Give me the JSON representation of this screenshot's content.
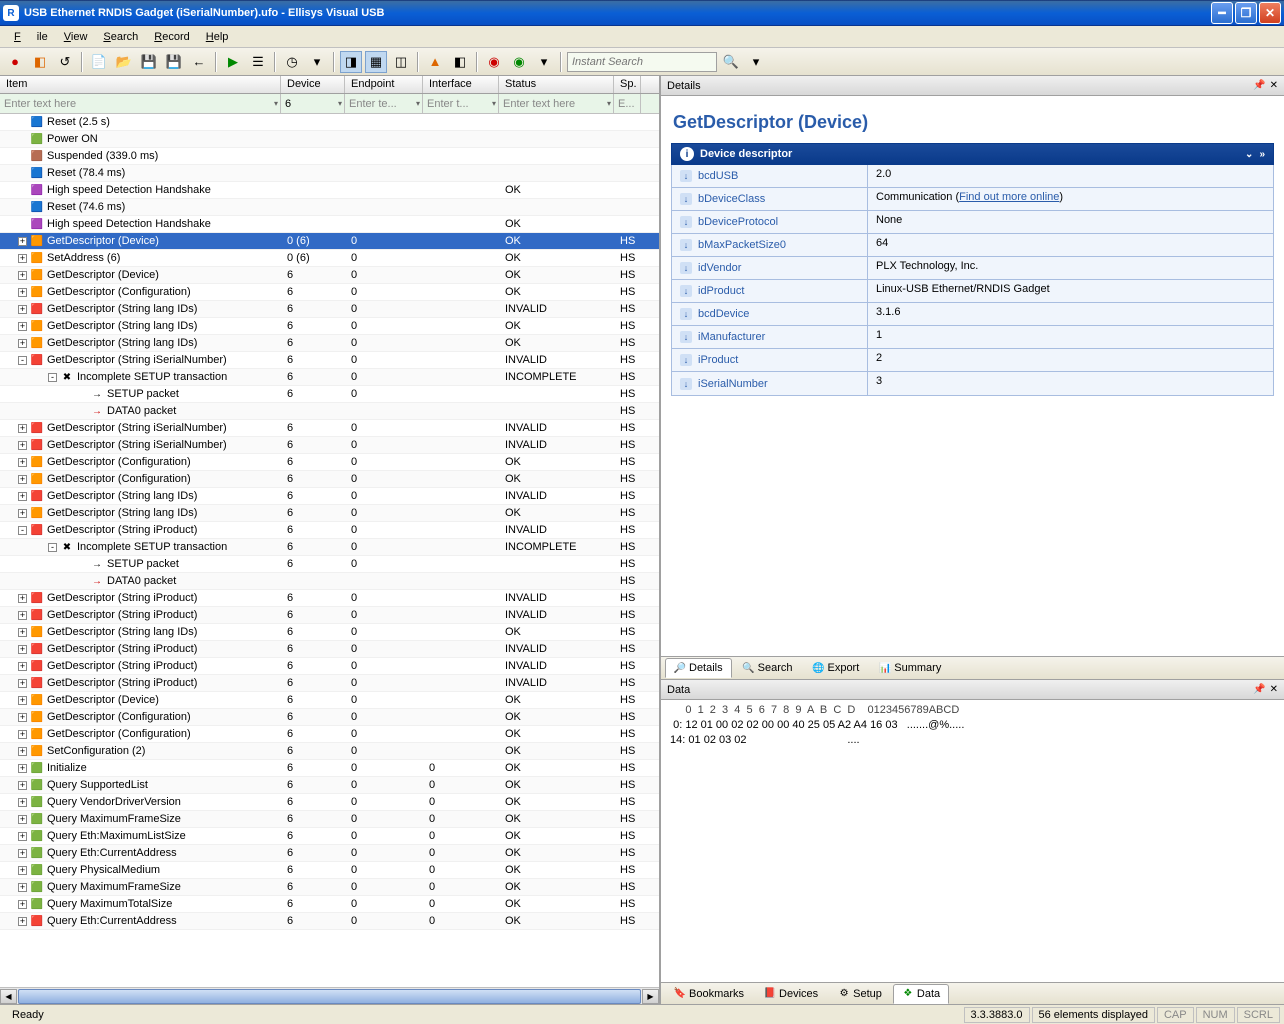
{
  "window": {
    "title": "USB Ethernet RNDIS Gadget (iSerialNumber).ufo - Ellisys Visual USB"
  },
  "menu": [
    "File",
    "View",
    "Search",
    "Record",
    "Help"
  ],
  "toolbar": {
    "search_placeholder": "Instant Search"
  },
  "grid": {
    "columns": [
      "Item",
      "Device",
      "Endpoint",
      "Interface",
      "Status",
      "Sp."
    ],
    "filters": {
      "item": "Enter text here",
      "device": "6",
      "endpoint": "Enter te...",
      "interface": "Enter t...",
      "status": "Enter text here",
      "sp": "E..."
    },
    "rows": [
      {
        "i": 1,
        "exp": "",
        "ind": 1,
        "ico": "🟦",
        "name": "Reset (2.5 s)"
      },
      {
        "i": 2,
        "exp": "",
        "ind": 1,
        "ico": "🟩",
        "name": "Power ON"
      },
      {
        "i": 3,
        "exp": "",
        "ind": 1,
        "ico": "🟫",
        "name": "Suspended (339.0 ms)"
      },
      {
        "i": 4,
        "exp": "",
        "ind": 1,
        "ico": "🟦",
        "name": "Reset (78.4 ms)"
      },
      {
        "i": 5,
        "exp": "",
        "ind": 1,
        "ico": "🟪",
        "name": "High speed Detection Handshake",
        "stat": "OK"
      },
      {
        "i": 6,
        "exp": "",
        "ind": 1,
        "ico": "🟦",
        "name": "Reset (74.6 ms)"
      },
      {
        "i": 7,
        "exp": "",
        "ind": 1,
        "ico": "🟪",
        "name": "High speed Detection Handshake",
        "stat": "OK"
      },
      {
        "i": 8,
        "exp": "+",
        "ind": 1,
        "ico": "🟧",
        "name": "GetDescriptor (Device)",
        "dev": "0 (6)",
        "end": "0",
        "stat": "OK",
        "sp": "HS",
        "sel": true
      },
      {
        "i": 9,
        "exp": "+",
        "ind": 1,
        "ico": "🟧",
        "name": "SetAddress (6)",
        "dev": "0 (6)",
        "end": "0",
        "stat": "OK",
        "sp": "HS"
      },
      {
        "i": 10,
        "exp": "+",
        "ind": 1,
        "ico": "🟧",
        "name": "GetDescriptor (Device)",
        "dev": "6",
        "end": "0",
        "stat": "OK",
        "sp": "HS"
      },
      {
        "i": 11,
        "exp": "+",
        "ind": 1,
        "ico": "🟧",
        "name": "GetDescriptor (Configuration)",
        "dev": "6",
        "end": "0",
        "stat": "OK",
        "sp": "HS"
      },
      {
        "i": 12,
        "exp": "+",
        "ind": 1,
        "ico": "🟥",
        "name": "GetDescriptor (String lang IDs)",
        "dev": "6",
        "end": "0",
        "stat": "INVALID",
        "sp": "HS"
      },
      {
        "i": 13,
        "exp": "+",
        "ind": 1,
        "ico": "🟧",
        "name": "GetDescriptor (String lang IDs)",
        "dev": "6",
        "end": "0",
        "stat": "OK",
        "sp": "HS"
      },
      {
        "i": 14,
        "exp": "+",
        "ind": 1,
        "ico": "🟧",
        "name": "GetDescriptor (String lang IDs)",
        "dev": "6",
        "end": "0",
        "stat": "OK",
        "sp": "HS"
      },
      {
        "i": 15,
        "exp": "-",
        "ind": 1,
        "ico": "🟥",
        "name": "GetDescriptor (String iSerialNumber)",
        "dev": "6",
        "end": "0",
        "stat": "INVALID",
        "sp": "HS"
      },
      {
        "i": 16,
        "exp": "-",
        "ind": 2,
        "ico": "✖",
        "name": "Incomplete SETUP transaction",
        "dev": "6",
        "end": "0",
        "stat": "INCOMPLETE",
        "sp": "HS"
      },
      {
        "i": 17,
        "exp": "",
        "ind": 3,
        "ico": "→",
        "name": "SETUP packet",
        "dev": "6",
        "end": "0",
        "sp": "HS"
      },
      {
        "i": 18,
        "exp": "",
        "ind": 3,
        "ico": "→",
        "icoCls": "i-red",
        "name": "DATA0 packet",
        "sp": "HS"
      },
      {
        "i": 19,
        "exp": "+",
        "ind": 1,
        "ico": "🟥",
        "name": "GetDescriptor (String iSerialNumber)",
        "dev": "6",
        "end": "0",
        "stat": "INVALID",
        "sp": "HS"
      },
      {
        "i": 20,
        "exp": "+",
        "ind": 1,
        "ico": "🟥",
        "name": "GetDescriptor (String iSerialNumber)",
        "dev": "6",
        "end": "0",
        "stat": "INVALID",
        "sp": "HS"
      },
      {
        "i": 21,
        "exp": "+",
        "ind": 1,
        "ico": "🟧",
        "name": "GetDescriptor (Configuration)",
        "dev": "6",
        "end": "0",
        "stat": "OK",
        "sp": "HS"
      },
      {
        "i": 22,
        "exp": "+",
        "ind": 1,
        "ico": "🟧",
        "name": "GetDescriptor (Configuration)",
        "dev": "6",
        "end": "0",
        "stat": "OK",
        "sp": "HS"
      },
      {
        "i": 23,
        "exp": "+",
        "ind": 1,
        "ico": "🟥",
        "name": "GetDescriptor (String lang IDs)",
        "dev": "6",
        "end": "0",
        "stat": "INVALID",
        "sp": "HS"
      },
      {
        "i": 24,
        "exp": "+",
        "ind": 1,
        "ico": "🟧",
        "name": "GetDescriptor (String lang IDs)",
        "dev": "6",
        "end": "0",
        "stat": "OK",
        "sp": "HS"
      },
      {
        "i": 25,
        "exp": "-",
        "ind": 1,
        "ico": "🟥",
        "name": "GetDescriptor (String iProduct)",
        "dev": "6",
        "end": "0",
        "stat": "INVALID",
        "sp": "HS"
      },
      {
        "i": 26,
        "exp": "-",
        "ind": 2,
        "ico": "✖",
        "name": "Incomplete SETUP transaction",
        "dev": "6",
        "end": "0",
        "stat": "INCOMPLETE",
        "sp": "HS"
      },
      {
        "i": 27,
        "exp": "",
        "ind": 3,
        "ico": "→",
        "name": "SETUP packet",
        "dev": "6",
        "end": "0",
        "sp": "HS"
      },
      {
        "i": 28,
        "exp": "",
        "ind": 3,
        "ico": "→",
        "icoCls": "i-red",
        "name": "DATA0 packet",
        "sp": "HS"
      },
      {
        "i": 29,
        "exp": "+",
        "ind": 1,
        "ico": "🟥",
        "name": "GetDescriptor (String iProduct)",
        "dev": "6",
        "end": "0",
        "stat": "INVALID",
        "sp": "HS"
      },
      {
        "i": 30,
        "exp": "+",
        "ind": 1,
        "ico": "🟥",
        "name": "GetDescriptor (String iProduct)",
        "dev": "6",
        "end": "0",
        "stat": "INVALID",
        "sp": "HS"
      },
      {
        "i": 31,
        "exp": "+",
        "ind": 1,
        "ico": "🟧",
        "name": "GetDescriptor (String lang IDs)",
        "dev": "6",
        "end": "0",
        "stat": "OK",
        "sp": "HS"
      },
      {
        "i": 32,
        "exp": "+",
        "ind": 1,
        "ico": "🟥",
        "name": "GetDescriptor (String iProduct)",
        "dev": "6",
        "end": "0",
        "stat": "INVALID",
        "sp": "HS"
      },
      {
        "i": 33,
        "exp": "+",
        "ind": 1,
        "ico": "🟥",
        "name": "GetDescriptor (String iProduct)",
        "dev": "6",
        "end": "0",
        "stat": "INVALID",
        "sp": "HS"
      },
      {
        "i": 34,
        "exp": "+",
        "ind": 1,
        "ico": "🟥",
        "name": "GetDescriptor (String iProduct)",
        "dev": "6",
        "end": "0",
        "stat": "INVALID",
        "sp": "HS"
      },
      {
        "i": 35,
        "exp": "+",
        "ind": 1,
        "ico": "🟧",
        "name": "GetDescriptor (Device)",
        "dev": "6",
        "end": "0",
        "stat": "OK",
        "sp": "HS"
      },
      {
        "i": 36,
        "exp": "+",
        "ind": 1,
        "ico": "🟧",
        "name": "GetDescriptor (Configuration)",
        "dev": "6",
        "end": "0",
        "stat": "OK",
        "sp": "HS"
      },
      {
        "i": 37,
        "exp": "+",
        "ind": 1,
        "ico": "🟧",
        "name": "GetDescriptor (Configuration)",
        "dev": "6",
        "end": "0",
        "stat": "OK",
        "sp": "HS"
      },
      {
        "i": 38,
        "exp": "+",
        "ind": 1,
        "ico": "🟧",
        "name": "SetConfiguration (2)",
        "dev": "6",
        "end": "0",
        "stat": "OK",
        "sp": "HS"
      },
      {
        "i": 39,
        "exp": "+",
        "ind": 1,
        "ico": "🟩",
        "name": "Initialize",
        "dev": "6",
        "end": "0",
        "int": "0",
        "stat": "OK",
        "sp": "HS"
      },
      {
        "i": 40,
        "exp": "+",
        "ind": 1,
        "ico": "🟩",
        "name": "Query SupportedList",
        "dev": "6",
        "end": "0",
        "int": "0",
        "stat": "OK",
        "sp": "HS"
      },
      {
        "i": 41,
        "exp": "+",
        "ind": 1,
        "ico": "🟩",
        "name": "Query VendorDriverVersion",
        "dev": "6",
        "end": "0",
        "int": "0",
        "stat": "OK",
        "sp": "HS"
      },
      {
        "i": 42,
        "exp": "+",
        "ind": 1,
        "ico": "🟩",
        "name": "Query MaximumFrameSize",
        "dev": "6",
        "end": "0",
        "int": "0",
        "stat": "OK",
        "sp": "HS"
      },
      {
        "i": 43,
        "exp": "+",
        "ind": 1,
        "ico": "🟩",
        "name": "Query Eth:MaximumListSize",
        "dev": "6",
        "end": "0",
        "int": "0",
        "stat": "OK",
        "sp": "HS"
      },
      {
        "i": 44,
        "exp": "+",
        "ind": 1,
        "ico": "🟩",
        "name": "Query Eth:CurrentAddress",
        "dev": "6",
        "end": "0",
        "int": "0",
        "stat": "OK",
        "sp": "HS"
      },
      {
        "i": 45,
        "exp": "+",
        "ind": 1,
        "ico": "🟩",
        "name": "Query PhysicalMedium",
        "dev": "6",
        "end": "0",
        "int": "0",
        "stat": "OK",
        "sp": "HS"
      },
      {
        "i": 46,
        "exp": "+",
        "ind": 1,
        "ico": "🟩",
        "name": "Query MaximumFrameSize",
        "dev": "6",
        "end": "0",
        "int": "0",
        "stat": "OK",
        "sp": "HS"
      },
      {
        "i": 47,
        "exp": "+",
        "ind": 1,
        "ico": "🟩",
        "name": "Query MaximumTotalSize",
        "dev": "6",
        "end": "0",
        "int": "0",
        "stat": "OK",
        "sp": "HS"
      },
      {
        "i": 48,
        "exp": "+",
        "ind": 1,
        "ico": "🟥",
        "name": "Query Eth:CurrentAddress",
        "dev": "6",
        "end": "0",
        "int": "0",
        "stat": "OK",
        "sp": "HS"
      }
    ]
  },
  "details": {
    "pane_title": "Details",
    "title": "GetDescriptor (Device)",
    "section": "Device descriptor",
    "rows": [
      {
        "k": "bcdUSB",
        "v": "2.0"
      },
      {
        "k": "bDeviceClass",
        "v": "Communication (",
        "link": "Find out more online",
        "v2": ")"
      },
      {
        "k": "bDeviceProtocol",
        "v": "None"
      },
      {
        "k": "bMaxPacketSize0",
        "v": "64"
      },
      {
        "k": "idVendor",
        "v": "PLX Technology, Inc."
      },
      {
        "k": "idProduct",
        "v": "Linux-USB Ethernet/RNDIS Gadget"
      },
      {
        "k": "bcdDevice",
        "v": "3.1.6"
      },
      {
        "k": "iManufacturer",
        "v": "1"
      },
      {
        "k": "iProduct",
        "v": "2"
      },
      {
        "k": "iSerialNumber",
        "v": "3"
      }
    ],
    "tabs": [
      "Details",
      "Search",
      "Export",
      "Summary"
    ]
  },
  "data_pane": {
    "title": "Data",
    "header": "      0  1  2  3  4  5  6  7  8  9  A  B  C  D    0123456789ABCD",
    "lines": [
      "  0: 12 01 00 02 02 00 00 40 25 05 A2 A4 16 03   .......@%.....",
      " 14: 01 02 03 02                                 ...."
    ],
    "tabs": [
      "Bookmarks",
      "Devices",
      "Setup",
      "Data"
    ]
  },
  "status": {
    "ready": "Ready",
    "ver": "3.3.3883.0",
    "elem": "56 elements displayed",
    "cap": "CAP",
    "num": "NUM",
    "scrl": "SCRL"
  }
}
